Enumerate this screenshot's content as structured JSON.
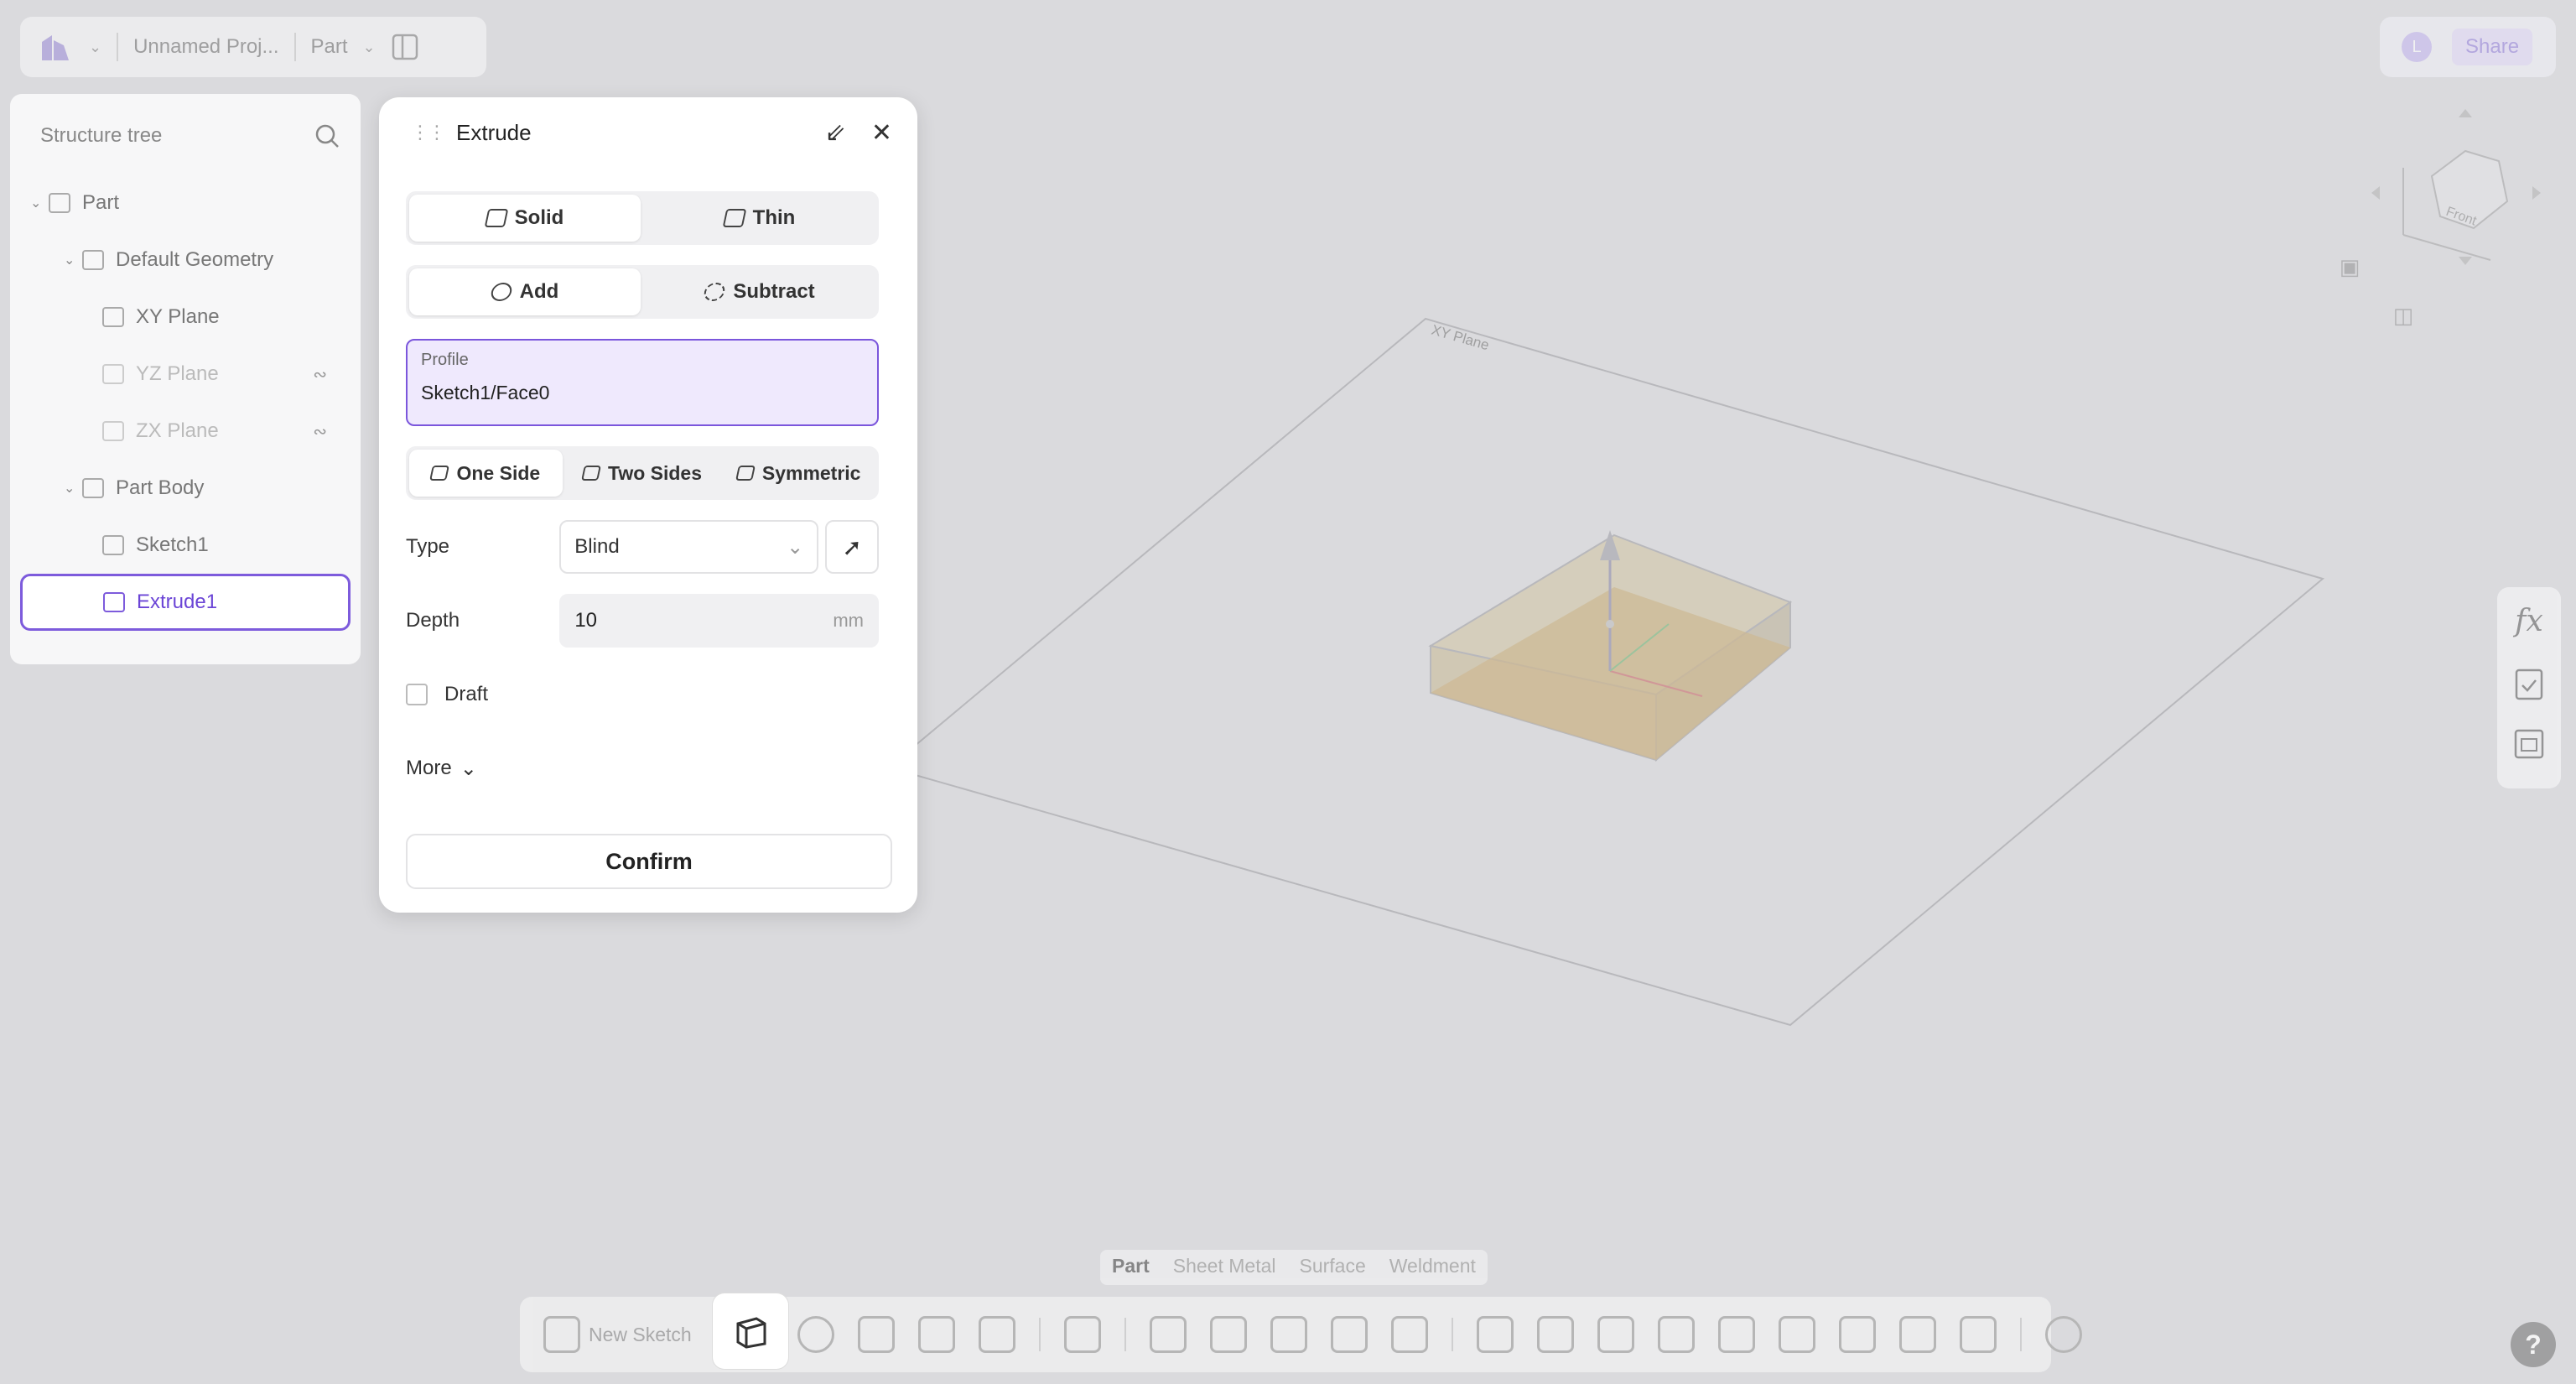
{
  "topbar": {
    "project_name": "Unnamed Proj...",
    "mode": "Part",
    "avatar_letter": "L",
    "share_label": "Share"
  },
  "tree": {
    "title": "Structure tree",
    "items": [
      {
        "label": "Part"
      },
      {
        "label": "Default Geometry"
      },
      {
        "label": "XY Plane"
      },
      {
        "label": "YZ Plane"
      },
      {
        "label": "ZX Plane"
      },
      {
        "label": "Part Body"
      },
      {
        "label": "Sketch1"
      },
      {
        "label": "Extrude1"
      }
    ]
  },
  "canvas": {
    "plane_label": "XY Plane",
    "view_cube_face": "Front"
  },
  "dialog": {
    "title": "Extrude",
    "body_type": {
      "options": [
        "Solid",
        "Thin"
      ],
      "selected": "Solid"
    },
    "operation": {
      "options": [
        "Add",
        "Subtract"
      ],
      "selected": "Add"
    },
    "profile": {
      "label": "Profile",
      "value": "Sketch1/Face0"
    },
    "direction": {
      "options": [
        "One Side",
        "Two Sides",
        "Symmetric"
      ],
      "selected": "One Side"
    },
    "type": {
      "label": "Type",
      "value": "Blind"
    },
    "depth": {
      "label": "Depth",
      "value": "10",
      "unit": "mm"
    },
    "draft": {
      "label": "Draft",
      "checked": false
    },
    "more_label": "More",
    "confirm_label": "Confirm"
  },
  "side_tools": {
    "fx_label": "fx"
  },
  "bottom": {
    "tabs": [
      "Part",
      "Sheet Metal",
      "Surface",
      "Weldment"
    ],
    "active_tab": "Part",
    "new_sketch_label": "New Sketch"
  },
  "help_label": "?",
  "colors": {
    "accent": "#7b56dc",
    "profile_bg": "#efe9fd",
    "selected_text": "#6b45d6"
  }
}
